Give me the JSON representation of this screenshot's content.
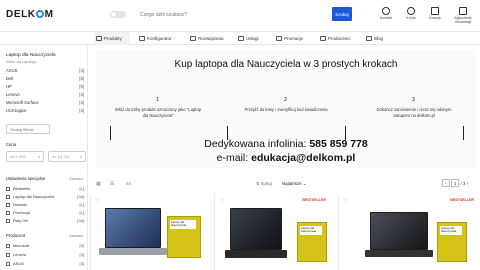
{
  "header": {
    "logo": [
      "DELK",
      "M"
    ],
    "search_placeholder": "Czego dziś szukasz?",
    "search_button": "Szukaj",
    "icons": [
      {
        "label": "Kontakt",
        "icon": "phone-icon"
      },
      {
        "label": "Konto",
        "icon": "user-icon"
      },
      {
        "label": "Koszyk",
        "icon": "cart-icon"
      },
      {
        "label": "Zgłoszenie reklamacji",
        "icon": "ticket-icon"
      }
    ]
  },
  "nav": {
    "items": [
      "Produkty",
      "Konfigurator",
      "Rozwiązania",
      "Usługi",
      "Promocje",
      "Producenci",
      "Blog"
    ],
    "active": 0
  },
  "sidebar": {
    "title": "Laptop dla Nauczyciela",
    "subtitle": "Wróć do Laptopy",
    "categories": [
      {
        "name": "ASUS",
        "count": "[3]"
      },
      {
        "name": "Dell",
        "count": "[8]"
      },
      {
        "name": "HP",
        "count": "[9]"
      },
      {
        "name": "Lenovo",
        "count": "[3]"
      },
      {
        "name": "Microsoft Surface",
        "count": "[3]"
      },
      {
        "name": "Uczniujące",
        "count": "[3]"
      }
    ],
    "search_placeholder": "Szukaj filtrów",
    "price_label": "Cena",
    "price_from": "od 2 409",
    "price_to": "do 14 711",
    "special_label": "Ustawienia specjalne",
    "clear": "Zaznacz",
    "special": [
      {
        "name": "Bestseller",
        "count": "[1]"
      },
      {
        "name": "Laptop dla Nauczyciela",
        "count": "[34]"
      },
      {
        "name": "Nowość",
        "count": "[1]"
      },
      {
        "name": "Promocja",
        "count": "[1]"
      },
      {
        "name": "Raty 0%",
        "count": "[34]"
      }
    ],
    "producer_label": "Producent",
    "producers": [
      {
        "name": "Microsoft",
        "count": "[3]"
      },
      {
        "name": "Lenovo",
        "count": "[3]"
      },
      {
        "name": "ASUS",
        "count": "[3]"
      }
    ]
  },
  "banner": {
    "title": "Kup laptopa dla Nauczyciela w 3 prostych krokach",
    "steps": [
      {
        "num": "1",
        "text": "Włóż do torby produkt oznaczony jako \"Laptop dla Nauczyciela\""
      },
      {
        "num": "2",
        "text": "Przejdź do kasy i zweryfikuj kod świadczenia"
      },
      {
        "num": "3",
        "text": "Dokończ zamówienie i ciesz się udanym zakupem na delkom.pl"
      }
    ],
    "hotline_prefix": "Dedykowana infolinia: ",
    "hotline_number": "585 859 778",
    "email_prefix": "e-mail: ",
    "email": "edukacja@delkom.pl"
  },
  "toolbar": {
    "count": "45",
    "sort_label": "Sortuj",
    "sort_value": "Najtańsze",
    "page": "1",
    "pages": "/ 3"
  },
  "products": [
    {
      "badge": "",
      "box_label": "Laptop dla Nauczyciela"
    },
    {
      "badge": "BESTSELLER",
      "box_label": "Laptop dla Nauczyciela"
    },
    {
      "badge": "BESTSELLER",
      "box_label": "Laptop dla Nauczyciela"
    }
  ]
}
